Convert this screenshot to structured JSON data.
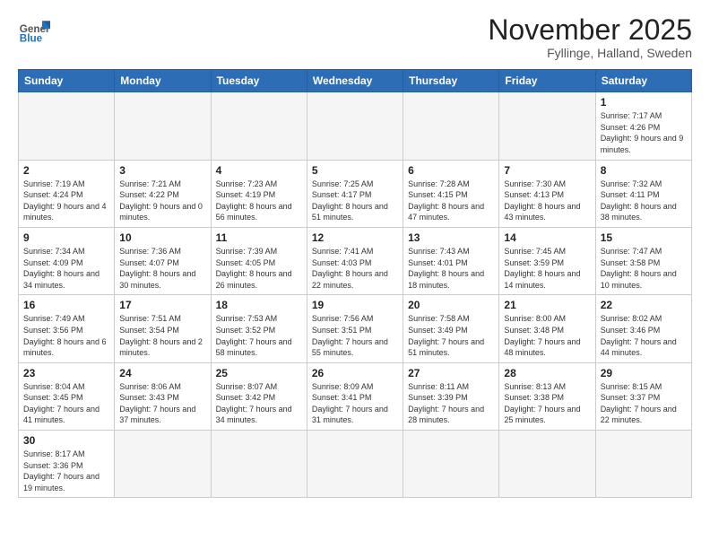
{
  "logo": {
    "text_general": "General",
    "text_blue": "Blue"
  },
  "title": {
    "month_year": "November 2025",
    "location": "Fyllinge, Halland, Sweden"
  },
  "weekdays": [
    "Sunday",
    "Monday",
    "Tuesday",
    "Wednesday",
    "Thursday",
    "Friday",
    "Saturday"
  ],
  "weeks": [
    [
      {
        "day": "",
        "info": ""
      },
      {
        "day": "",
        "info": ""
      },
      {
        "day": "",
        "info": ""
      },
      {
        "day": "",
        "info": ""
      },
      {
        "day": "",
        "info": ""
      },
      {
        "day": "",
        "info": ""
      },
      {
        "day": "1",
        "info": "Sunrise: 7:17 AM\nSunset: 4:26 PM\nDaylight: 9 hours and 9 minutes."
      }
    ],
    [
      {
        "day": "2",
        "info": "Sunrise: 7:19 AM\nSunset: 4:24 PM\nDaylight: 9 hours and 4 minutes."
      },
      {
        "day": "3",
        "info": "Sunrise: 7:21 AM\nSunset: 4:22 PM\nDaylight: 9 hours and 0 minutes."
      },
      {
        "day": "4",
        "info": "Sunrise: 7:23 AM\nSunset: 4:19 PM\nDaylight: 8 hours and 56 minutes."
      },
      {
        "day": "5",
        "info": "Sunrise: 7:25 AM\nSunset: 4:17 PM\nDaylight: 8 hours and 51 minutes."
      },
      {
        "day": "6",
        "info": "Sunrise: 7:28 AM\nSunset: 4:15 PM\nDaylight: 8 hours and 47 minutes."
      },
      {
        "day": "7",
        "info": "Sunrise: 7:30 AM\nSunset: 4:13 PM\nDaylight: 8 hours and 43 minutes."
      },
      {
        "day": "8",
        "info": "Sunrise: 7:32 AM\nSunset: 4:11 PM\nDaylight: 8 hours and 38 minutes."
      }
    ],
    [
      {
        "day": "9",
        "info": "Sunrise: 7:34 AM\nSunset: 4:09 PM\nDaylight: 8 hours and 34 minutes."
      },
      {
        "day": "10",
        "info": "Sunrise: 7:36 AM\nSunset: 4:07 PM\nDaylight: 8 hours and 30 minutes."
      },
      {
        "day": "11",
        "info": "Sunrise: 7:39 AM\nSunset: 4:05 PM\nDaylight: 8 hours and 26 minutes."
      },
      {
        "day": "12",
        "info": "Sunrise: 7:41 AM\nSunset: 4:03 PM\nDaylight: 8 hours and 22 minutes."
      },
      {
        "day": "13",
        "info": "Sunrise: 7:43 AM\nSunset: 4:01 PM\nDaylight: 8 hours and 18 minutes."
      },
      {
        "day": "14",
        "info": "Sunrise: 7:45 AM\nSunset: 3:59 PM\nDaylight: 8 hours and 14 minutes."
      },
      {
        "day": "15",
        "info": "Sunrise: 7:47 AM\nSunset: 3:58 PM\nDaylight: 8 hours and 10 minutes."
      }
    ],
    [
      {
        "day": "16",
        "info": "Sunrise: 7:49 AM\nSunset: 3:56 PM\nDaylight: 8 hours and 6 minutes."
      },
      {
        "day": "17",
        "info": "Sunrise: 7:51 AM\nSunset: 3:54 PM\nDaylight: 8 hours and 2 minutes."
      },
      {
        "day": "18",
        "info": "Sunrise: 7:53 AM\nSunset: 3:52 PM\nDaylight: 7 hours and 58 minutes."
      },
      {
        "day": "19",
        "info": "Sunrise: 7:56 AM\nSunset: 3:51 PM\nDaylight: 7 hours and 55 minutes."
      },
      {
        "day": "20",
        "info": "Sunrise: 7:58 AM\nSunset: 3:49 PM\nDaylight: 7 hours and 51 minutes."
      },
      {
        "day": "21",
        "info": "Sunrise: 8:00 AM\nSunset: 3:48 PM\nDaylight: 7 hours and 48 minutes."
      },
      {
        "day": "22",
        "info": "Sunrise: 8:02 AM\nSunset: 3:46 PM\nDaylight: 7 hours and 44 minutes."
      }
    ],
    [
      {
        "day": "23",
        "info": "Sunrise: 8:04 AM\nSunset: 3:45 PM\nDaylight: 7 hours and 41 minutes."
      },
      {
        "day": "24",
        "info": "Sunrise: 8:06 AM\nSunset: 3:43 PM\nDaylight: 7 hours and 37 minutes."
      },
      {
        "day": "25",
        "info": "Sunrise: 8:07 AM\nSunset: 3:42 PM\nDaylight: 7 hours and 34 minutes."
      },
      {
        "day": "26",
        "info": "Sunrise: 8:09 AM\nSunset: 3:41 PM\nDaylight: 7 hours and 31 minutes."
      },
      {
        "day": "27",
        "info": "Sunrise: 8:11 AM\nSunset: 3:39 PM\nDaylight: 7 hours and 28 minutes."
      },
      {
        "day": "28",
        "info": "Sunrise: 8:13 AM\nSunset: 3:38 PM\nDaylight: 7 hours and 25 minutes."
      },
      {
        "day": "29",
        "info": "Sunrise: 8:15 AM\nSunset: 3:37 PM\nDaylight: 7 hours and 22 minutes."
      }
    ],
    [
      {
        "day": "30",
        "info": "Sunrise: 8:17 AM\nSunset: 3:36 PM\nDaylight: 7 hours and 19 minutes."
      },
      {
        "day": "",
        "info": ""
      },
      {
        "day": "",
        "info": ""
      },
      {
        "day": "",
        "info": ""
      },
      {
        "day": "",
        "info": ""
      },
      {
        "day": "",
        "info": ""
      },
      {
        "day": "",
        "info": ""
      }
    ]
  ]
}
